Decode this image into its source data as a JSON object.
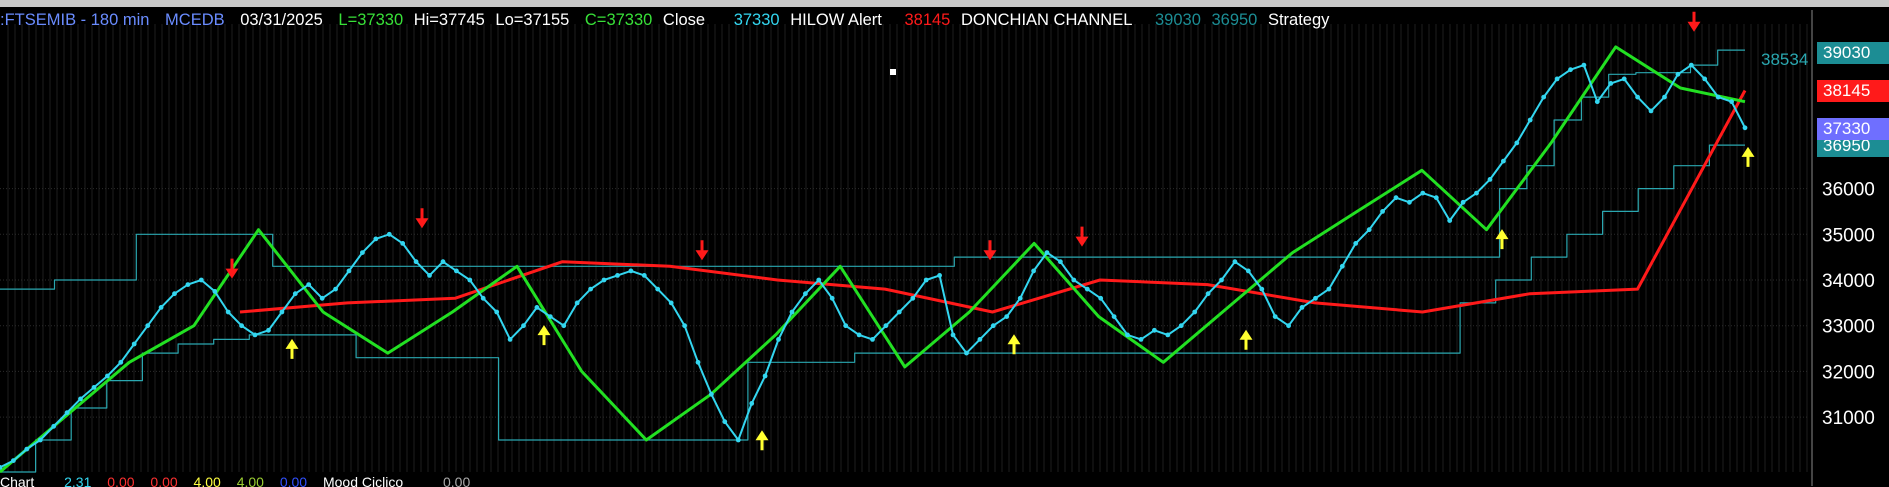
{
  "header": {
    "symbol": ":FTSEMIB - 180 min",
    "source": "MCEDB",
    "date": "03/31/2025",
    "low": "L=37330",
    "high": "Hi=37745",
    "lo": "Lo=37155",
    "close_c": "C=37330",
    "close_label": "Close",
    "close_value": "37330",
    "hilow_label": "HILOW Alert",
    "hilow_value": "38145",
    "donchian_label": "DONCHIAN CHANNEL",
    "donchian_upper": "39030",
    "donchian_lower": "36950",
    "strategy_label": "Strategy"
  },
  "footer": {
    "chart_label": "Chart",
    "v1": "2.31",
    "v2": "0.00",
    "v3": "0.00",
    "v4": "4.00",
    "v5": "4.00",
    "v6": "0.00",
    "cycle_label": "Mood Ciclico",
    "v7": "0.00"
  },
  "price_labels": {
    "upper": "39030",
    "mid_level": "38534",
    "hilow": "38145",
    "close": "37330",
    "lower": "36950"
  },
  "colors": {
    "background": "#000000",
    "price": "#33d6f0",
    "green_lines": "#22e022",
    "red_line": "#ff1a1a",
    "channel": "#2aa7b0",
    "close_box": "#6f6fff",
    "hilow_box": "#ff1a1a",
    "upper_box": "#1c8d94"
  },
  "chart_data": {
    "type": "line",
    "title": ":FTSEMIB - 180 min",
    "xlabel": "",
    "ylabel": "",
    "ylim": [
      29800,
      39600
    ],
    "grid": true,
    "yticks": [
      31000,
      32000,
      33000,
      34000,
      35000,
      36000
    ],
    "series": [
      {
        "name": "Close",
        "values": [
          29900,
          30050,
          30300,
          30500,
          30800,
          31100,
          31400,
          31650,
          31900,
          32200,
          32600,
          33000,
          33400,
          33700,
          33900,
          34000,
          33750,
          33300,
          33000,
          32800,
          32900,
          33300,
          33700,
          33900,
          33600,
          33800,
          34200,
          34600,
          34900,
          35000,
          34800,
          34400,
          34100,
          34400,
          34200,
          34000,
          33600,
          33300,
          32700,
          33000,
          33400,
          33200,
          33000,
          33500,
          33800,
          34000,
          34100,
          34200,
          34100,
          33800,
          33500,
          33000,
          32200,
          31500,
          30900,
          30500,
          31300,
          31900,
          32700,
          33300,
          33700,
          34000,
          33600,
          33000,
          32800,
          32700,
          33000,
          33300,
          33600,
          34000,
          34100,
          32800,
          32400,
          32700,
          33000,
          33200,
          33600,
          34200,
          34600,
          34400,
          34000,
          33800,
          33600,
          33200,
          32800,
          32700,
          32900,
          32800,
          33000,
          33300,
          33700,
          34000,
          34400,
          34200,
          33800,
          33200,
          33000,
          33400,
          33600,
          33800,
          34300,
          34800,
          35100,
          35500,
          35800,
          35700,
          35900,
          35800,
          35300,
          35700,
          35900,
          36200,
          36600,
          37000,
          37500,
          38000,
          38400,
          38600,
          38700,
          37900,
          38300,
          38400,
          38000,
          37700,
          38000,
          38500,
          38700,
          38400,
          38000,
          37900,
          37330
        ]
      },
      {
        "name": "DONCHIAN CHANNEL upper",
        "values": [
          33800,
          33800,
          34000,
          34000,
          34000,
          35000,
          35000,
          35000,
          35000,
          35000,
          34300,
          34300,
          34300,
          34300,
          34300,
          34300,
          34300,
          34300,
          34300,
          34300,
          34300,
          34300,
          34300,
          34300,
          34300,
          34300,
          34300,
          34300,
          34300,
          34300,
          34300,
          34300,
          34300,
          34300,
          34300,
          34500,
          34500,
          34500,
          34500,
          34500,
          34500,
          34500,
          34500,
          34500,
          34500,
          34500,
          34500,
          34500,
          34500,
          34500,
          34500,
          34500,
          34500,
          34500,
          34500,
          36000,
          36500,
          37500,
          38000,
          38500,
          38534,
          38534,
          38700,
          39030,
          39030
        ]
      },
      {
        "name": "DONCHIAN CHANNEL lower",
        "values": [
          29800,
          30500,
          31200,
          31800,
          32400,
          32600,
          32700,
          32800,
          32800,
          32800,
          32300,
          32300,
          32300,
          32300,
          30500,
          30500,
          30500,
          30500,
          30500,
          30500,
          30500,
          32200,
          32200,
          32200,
          32400,
          32400,
          32400,
          32400,
          32400,
          32400,
          32400,
          32400,
          32400,
          32400,
          32400,
          32400,
          32400,
          32400,
          32400,
          32400,
          32400,
          33500,
          34000,
          34500,
          35000,
          35500,
          36000,
          36500,
          36950,
          36950
        ]
      },
      {
        "name": "Strategy",
        "values": [
          29800,
          31000,
          32200,
          33000,
          35100,
          33300,
          32400,
          33300,
          34300,
          32000,
          30500,
          31500,
          32800,
          34300,
          32100,
          33300,
          34800,
          33200,
          32200,
          33400,
          34600,
          35500,
          36400,
          35100,
          37000,
          39100,
          38200,
          37900
        ]
      },
      {
        "name": "HILOW Alert",
        "values": [
          33300,
          33500,
          33600,
          34400,
          34300,
          34000,
          33800,
          33300,
          34000,
          33900,
          33500,
          33300,
          33700,
          33800,
          38145
        ]
      }
    ],
    "markers": {
      "sell_arrows": [
        33900,
        35000,
        34300,
        34300,
        34600,
        39300
      ],
      "buy_arrows": [
        32800,
        33100,
        30800,
        32900,
        33000,
        35200,
        37000
      ]
    }
  }
}
